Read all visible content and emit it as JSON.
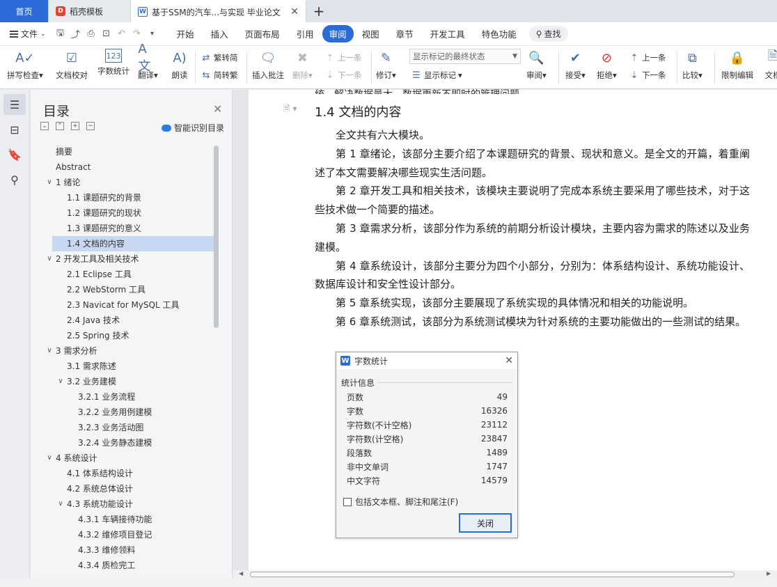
{
  "tabs": {
    "home": "首页",
    "template": "稻壳模板",
    "document": "基于SSM的汽车...与实现 毕业论文",
    "template_logo": "D",
    "doc_logo": "W"
  },
  "menu": {
    "file": "文件",
    "tabs": [
      "开始",
      "插入",
      "页面布局",
      "引用",
      "审阅",
      "视图",
      "章节",
      "开发工具",
      "特色功能"
    ],
    "active_tab": "审阅",
    "search": "查找"
  },
  "ribbon": {
    "spell_check": "拼写检查",
    "doc_proof": "文档校对",
    "word_count": "字数统计",
    "translate": "翻译",
    "read_aloud": "朗读",
    "trad_to_simp": "繁转简",
    "simp_to_trad": "简转繁",
    "insert_comment": "插入批注",
    "delete": "删除",
    "prev_comment": "上一条",
    "next_comment": "下一条",
    "revise": "修订",
    "markup_state": "显示标记的最终状态",
    "show_markup": "显示标记",
    "review": "审阅",
    "accept": "接受",
    "reject": "拒绝",
    "prev": "上一条",
    "next": "下一条",
    "compare": "比较",
    "restrict_edit": "限制编辑",
    "doc_more": "文档"
  },
  "toc": {
    "title": "目录",
    "smart_detect": "智能识别目录",
    "items": [
      {
        "label": "摘要",
        "level": 0,
        "twisty": ""
      },
      {
        "label": "Abstract",
        "level": 0,
        "twisty": ""
      },
      {
        "label": "1  绪论",
        "level": 0,
        "twisty": "v"
      },
      {
        "label": "1.1  课题研究的背景",
        "level": 1,
        "twisty": ""
      },
      {
        "label": "1.2  课题研究的现状",
        "level": 1,
        "twisty": ""
      },
      {
        "label": "1.3  课题研究的意义",
        "level": 1,
        "twisty": ""
      },
      {
        "label": "1.4  文档的内容",
        "level": 1,
        "twisty": "",
        "selected": true
      },
      {
        "label": "2  开发工具及相关技术",
        "level": 0,
        "twisty": "v"
      },
      {
        "label": "2.1 Eclipse 工具",
        "level": 1,
        "twisty": ""
      },
      {
        "label": "2.2 WebStorm 工具",
        "level": 1,
        "twisty": ""
      },
      {
        "label": "2.3 Navicat for MySQL 工具",
        "level": 1,
        "twisty": ""
      },
      {
        "label": "2.4 Java 技术",
        "level": 1,
        "twisty": ""
      },
      {
        "label": "2.5 Spring 技术",
        "level": 1,
        "twisty": ""
      },
      {
        "label": "3  需求分析",
        "level": 0,
        "twisty": "v"
      },
      {
        "label": "3.1  需求陈述",
        "level": 1,
        "twisty": ""
      },
      {
        "label": "3.2  业务建模",
        "level": 1,
        "twisty": "v"
      },
      {
        "label": "3.2.1  业务流程",
        "level": 2,
        "twisty": ""
      },
      {
        "label": "3.2.2  业务用例建模",
        "level": 2,
        "twisty": ""
      },
      {
        "label": "3.2.3  业务活动图",
        "level": 2,
        "twisty": ""
      },
      {
        "label": "3.2.4  业务静态建模",
        "level": 2,
        "twisty": ""
      },
      {
        "label": "4  系统设计",
        "level": 0,
        "twisty": "v"
      },
      {
        "label": "4.1  体系结构设计",
        "level": 1,
        "twisty": ""
      },
      {
        "label": "4.2  系统总体设计",
        "level": 1,
        "twisty": ""
      },
      {
        "label": "4.3  系统功能设计",
        "level": 1,
        "twisty": "v"
      },
      {
        "label": "4.3.1  车辆接待功能",
        "level": 2,
        "twisty": ""
      },
      {
        "label": "4.3.2  维修项目登记",
        "level": 2,
        "twisty": ""
      },
      {
        "label": "4.3.3  维修领料",
        "level": 2,
        "twisty": ""
      },
      {
        "label": "4.3.4  质检完工",
        "level": 2,
        "twisty": ""
      }
    ]
  },
  "document": {
    "cut_line": "统，解决数据量大，数据更新不即时的管理问题。",
    "heading": "1.4  文档的内容",
    "paragraphs": [
      "全文共有六大模块。",
      "第 1 章绪论，该部分主要介绍了本课题研究的背景、现状和意义。是全文的开篇，着重阐述了本文需要解决哪些现实生活问题。",
      "第 2 章开发工具和相关技术，该模块主要说明了完成本系统主要采用了哪些技术，对于这些技术做一个简要的描述。",
      "第 3 章需求分析，该部分作为系统的前期分析设计模块，主要内容为需求的陈述以及业务建模。",
      "第 4 章系统设计，该部分主要分为四个小部分，分别为：体系结构设计、系统功能设计、数据库设计和安全性设计部分。",
      "第 5 章系统实现，该部分主要展现了系统实现的具体情况和相关的功能说明。",
      "第 6 章系统测试，该部分为系统测试模块为针对系统的主要功能做出的一些测试的结果。"
    ]
  },
  "word_count_dialog": {
    "title": "字数统计",
    "logo": "W",
    "group_label": "统计信息",
    "rows": [
      {
        "label": "页数",
        "value": "49"
      },
      {
        "label": "字数",
        "value": "16326"
      },
      {
        "label": "字符数(不计空格)",
        "value": "23112"
      },
      {
        "label": "字符数(计空格)",
        "value": "23847"
      },
      {
        "label": "段落数",
        "value": "1489"
      },
      {
        "label": "非中文单词",
        "value": "1747"
      },
      {
        "label": "中文字符",
        "value": "14579"
      }
    ],
    "include_checkbox": "包括文本框、脚注和尾注(F)",
    "close_button": "关闭"
  }
}
